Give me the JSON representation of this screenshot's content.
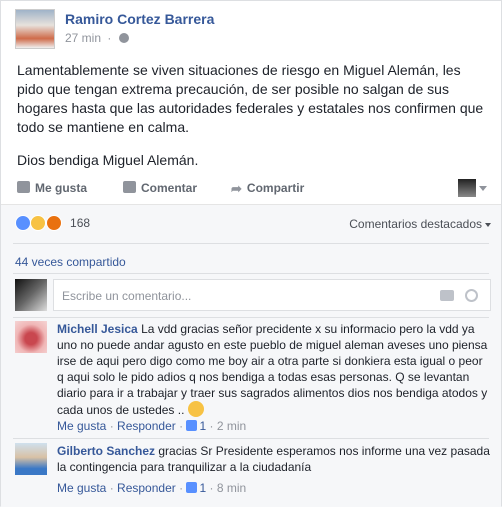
{
  "post": {
    "author": "Ramiro Cortez Barrera",
    "time": "27 min",
    "paragraph1": "Lamentablemente se viven situaciones de riesgo en Miguel Alemán, les pido que tengan extrema precaución, de ser posible no salgan de sus hogares hasta que las autoridades federales y estatales nos confirmen que todo se mantiene en calma.",
    "paragraph2": "Dios bendiga Miguel Alemán."
  },
  "actions": {
    "like": "Me gusta",
    "comment": "Comentar",
    "share": "Compartir"
  },
  "reactions": {
    "count": "168",
    "highlight_label": "Comentarios destacados"
  },
  "shares": "44 veces compartido",
  "compose": {
    "placeholder": "Escribe un comentario..."
  },
  "comments": [
    {
      "name": "Michell Jesica",
      "text": "La vdd gracias señor precidente x su informacio pero la vdd ya uno no puede andar agusto en este pueblo de miguel aleman aveses uno piensa irse de aqui pero digo como me boy air a otra parte si donkiera esta igual o peor q aqui solo le pido adios q nos bendiga a todas esas personas. Q se levantan diario para ir a trabajar y traer sus sagrados alimentos dios nos bendiga atodos y cada unos de ustedes ..",
      "like": "Me gusta",
      "reply": "Responder",
      "likes": "1",
      "time": "2 min"
    },
    {
      "name": "Gilberto Sanchez",
      "text": "gracias Sr Presidente esperamos nos informe una vez pasada la contingencia para tranquilizar a la ciudadanía",
      "like": "Me gusta",
      "reply": "Responder",
      "likes": "1",
      "time": "8 min"
    }
  ],
  "colors": {
    "link": "#365899",
    "meta": "#90949c",
    "like": "#5890ff"
  }
}
